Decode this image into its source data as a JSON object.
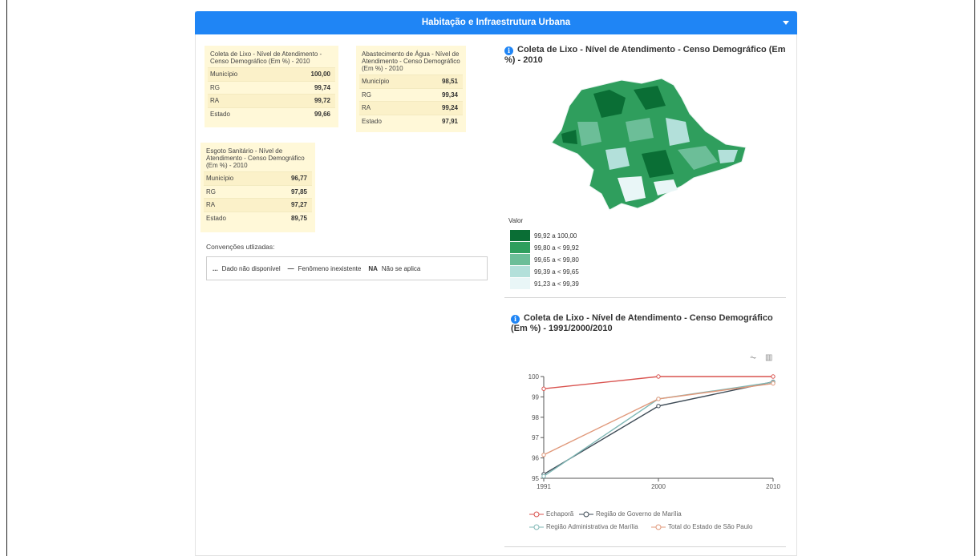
{
  "header": {
    "title": "Habitação e Infraestrutura Urbana"
  },
  "cards": [
    {
      "title": "Coleta de Lixo - Nível de Atendimento - Censo Demográfico (Em %) - 2010",
      "rows": [
        {
          "label": "Município",
          "value": "100,00"
        },
        {
          "label": "RG",
          "value": "99,74"
        },
        {
          "label": "RA",
          "value": "99,72"
        },
        {
          "label": "Estado",
          "value": "99,66"
        }
      ]
    },
    {
      "title": "Abastecimento de Água - Nível de Atendimento - Censo Demográfico (Em %) - 2010",
      "rows": [
        {
          "label": "Município",
          "value": "98,51"
        },
        {
          "label": "RG",
          "value": "99,34"
        },
        {
          "label": "RA",
          "value": "99,24"
        },
        {
          "label": "Estado",
          "value": "97,91"
        }
      ]
    },
    {
      "title": "Esgoto Sanitário - Nível de Atendimento - Censo Demográfico (Em %) - 2010",
      "rows": [
        {
          "label": "Município",
          "value": "96,77"
        },
        {
          "label": "RG",
          "value": "97,85"
        },
        {
          "label": "RA",
          "value": "97,27"
        },
        {
          "label": "Estado",
          "value": "89,75"
        }
      ]
    }
  ],
  "conventions": {
    "label": "Convenções utlizadas:",
    "items": [
      {
        "symbol": "...",
        "text": "Dado não disponível"
      },
      {
        "symbol": "—",
        "text": "Fenômeno inexistente"
      },
      {
        "symbol": "NA",
        "text": "Não se aplica"
      }
    ]
  },
  "map_section": {
    "title": "Coleta de Lixo - Nível de Atendimento - Censo Demográfico (Em %) - 2010",
    "legend_title": "Valor",
    "legend": [
      {
        "label": "99,92 a 100,00",
        "color": "#0a6e35"
      },
      {
        "label": "99,80 a < 99,92",
        "color": "#2f9e5d"
      },
      {
        "label": "99,65 a < 99,80",
        "color": "#6cbe98"
      },
      {
        "label": "99,39 a < 99,65",
        "color": "#b3e0da"
      },
      {
        "label": "91,23 a < 99,39",
        "color": "#e9f6f7"
      }
    ]
  },
  "chart_section": {
    "title": "Coleta de Lixo - Nível de Atendimento - Censo Demográfico (Em %) - 1991/2000/2010",
    "toolbox": [
      "line-chart-icon",
      "bar-chart-icon"
    ]
  },
  "chart_data": {
    "type": "line",
    "x": [
      "1991",
      "2000",
      "2010"
    ],
    "ylim": [
      95,
      100
    ],
    "yticks": [
      95,
      96,
      97,
      98,
      99,
      100
    ],
    "grid": false,
    "legend_position": "bottom",
    "series": [
      {
        "name": "Echaporã",
        "values": [
          99.4,
          100.0,
          100.0
        ],
        "color": "#d9534f"
      },
      {
        "name": "Região de Governo de Marília",
        "values": [
          95.2,
          98.55,
          99.74
        ],
        "color": "#3d4a55"
      },
      {
        "name": "Região Administrativa de Marília",
        "values": [
          95.1,
          98.9,
          99.72
        ],
        "color": "#7fb7b5"
      },
      {
        "name": "Total do Estado de São Paulo",
        "values": [
          96.15,
          98.9,
          99.66
        ],
        "color": "#e0987a"
      }
    ]
  }
}
